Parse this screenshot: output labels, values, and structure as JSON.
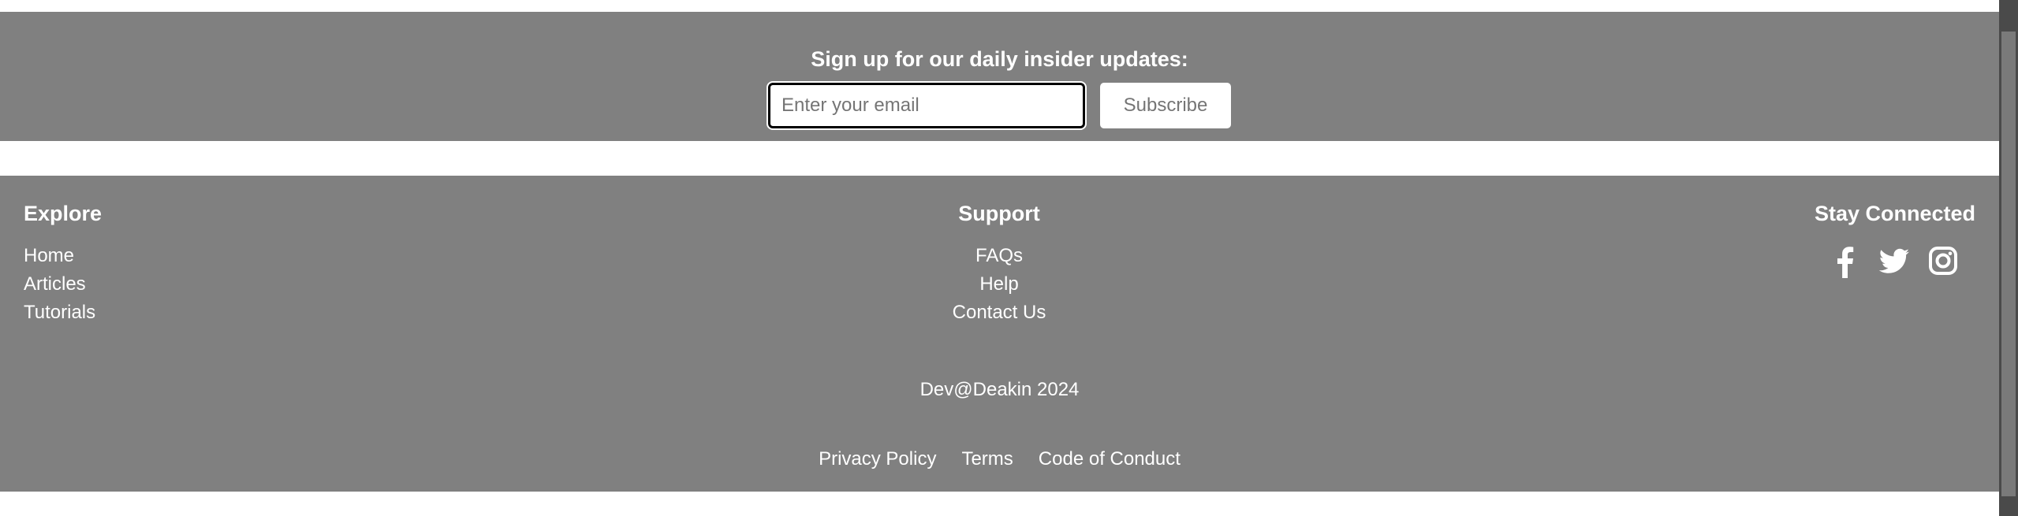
{
  "newsletter": {
    "title": "Sign up for our daily insider updates:",
    "email_placeholder": "Enter your email",
    "email_value": "",
    "subscribe_label": "Subscribe"
  },
  "footer": {
    "explore": {
      "heading": "Explore",
      "links": [
        "Home",
        "Articles",
        "Tutorials"
      ]
    },
    "support": {
      "heading": "Support",
      "links": [
        "FAQs",
        "Help",
        "Contact Us"
      ]
    },
    "connect": {
      "heading": "Stay Connected",
      "icons": [
        "facebook-icon",
        "twitter-icon",
        "instagram-icon"
      ]
    },
    "copyright": "Dev@Deakin 2024",
    "legal_links": [
      "Privacy Policy",
      "Terms",
      "Code of Conduct"
    ]
  },
  "colors": {
    "band_background": "#808080",
    "text": "#ffffff",
    "page_background": "#ffffff"
  }
}
